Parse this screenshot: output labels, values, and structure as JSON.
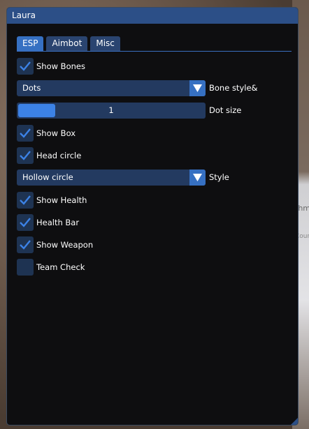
{
  "window": {
    "title": "Laura"
  },
  "tabs": [
    {
      "label": "ESP",
      "active": true
    },
    {
      "label": "Aimbot",
      "active": false
    },
    {
      "label": "Misc",
      "active": false
    }
  ],
  "controls": {
    "show_bones": {
      "label": "Show Bones",
      "checked": true
    },
    "bone_style": {
      "value": "Dots",
      "label": "Bone style&"
    },
    "dot_size": {
      "value": "1",
      "label": "Dot size",
      "fill_fraction": 0.2
    },
    "show_box": {
      "label": "Show Box",
      "checked": true
    },
    "head_circle": {
      "label": "Head circle",
      "checked": true
    },
    "style": {
      "value": "Hollow circle",
      "label": "Style"
    },
    "show_health": {
      "label": "Show Health",
      "checked": true
    },
    "health_bar": {
      "label": "Health Bar",
      "checked": true
    },
    "show_weapon": {
      "label": "Show Weapon",
      "checked": true
    },
    "team_check": {
      "label": "Team Check",
      "checked": false
    }
  },
  "background": {
    "text1": "thm",
    "text2": "Coun"
  },
  "colors": {
    "title_bar": "#2c4f87",
    "accent": "#3670c2",
    "checkmark": "#3c82e6",
    "frame_bg": "#233a60",
    "window_bg": "#0e0e10"
  }
}
